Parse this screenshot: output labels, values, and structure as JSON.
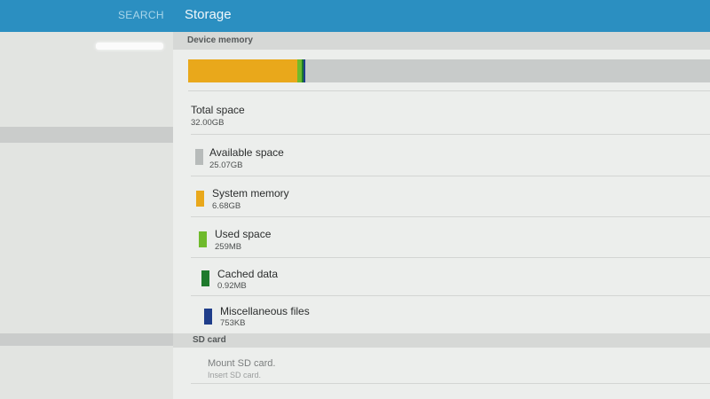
{
  "topbar": {
    "search_label": "SEARCH",
    "title": "Storage"
  },
  "device_memory": {
    "header": "Device memory",
    "total": {
      "label": "Total space",
      "value": "32.00GB"
    },
    "bar": [
      {
        "name": "System memory",
        "fraction": 0.2088,
        "color": "#e9a81b"
      },
      {
        "name": "Used space",
        "fraction": 0.0079,
        "color": "#6fba2c"
      },
      {
        "name": "Cached data",
        "fraction": 0.0015,
        "color": "#1e7a2c"
      },
      {
        "name": "Miscellaneous files",
        "fraction": 0.003,
        "color": "#1f3d8a"
      },
      {
        "name": "Available space",
        "fraction": 0.7788,
        "color": "#c8cbca"
      }
    ],
    "items": [
      {
        "label": "Available space",
        "value": "25.07GB",
        "color": "#b7bbba"
      },
      {
        "label": "System memory",
        "value": "6.68GB",
        "color": "#e9a81b"
      },
      {
        "label": "Used space",
        "value": "259MB",
        "color": "#6fba2c"
      },
      {
        "label": "Cached data",
        "value": "0.92MB",
        "color": "#1e7a2c"
      },
      {
        "label": "Miscellaneous files",
        "value": "753KB",
        "color": "#1f3d8a"
      }
    ]
  },
  "sd_card": {
    "header": "SD card",
    "mount_title": "Mount SD card.",
    "mount_sub": "Insert SD card."
  }
}
